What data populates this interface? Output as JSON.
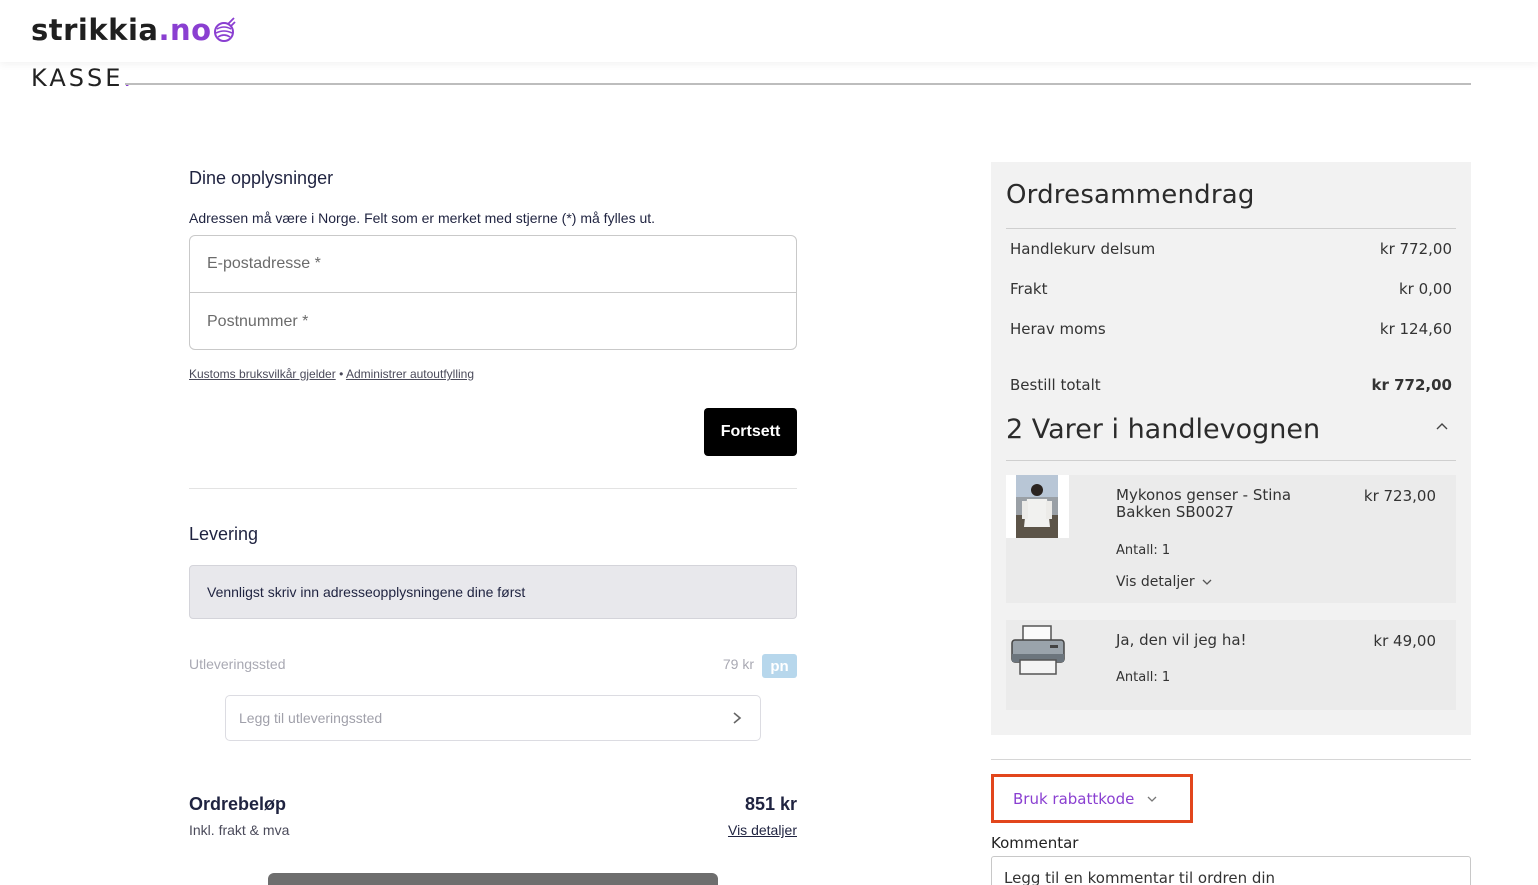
{
  "header": {
    "logo_text": "strikkia",
    "logo_accent": ".no",
    "brand_color": "#8a3fd1"
  },
  "page": {
    "title": "KASSE",
    "title_dot": "."
  },
  "customer": {
    "heading": "Dine opplysninger",
    "hint": "Adressen må være i Norge. Felt som er merket med stjerne (*) må fylles ut.",
    "email_placeholder": "E-postadresse *",
    "postcode_placeholder": "Postnummer *",
    "terms_link": "Kustoms bruksvilkår gjelder",
    "separator": "•",
    "autofill_link": "Administrer autoutfylling",
    "continue_label": "Fortsett"
  },
  "delivery": {
    "heading": "Levering",
    "notice": "Vennligst skriv inn adresseopplysningene dine først",
    "pickup_label": "Utleveringssted",
    "pickup_price": "79 kr",
    "carrier_badge": "pn",
    "pickup_placeholder": "Legg til utleveringssted"
  },
  "order_total": {
    "label": "Ordrebeløp",
    "sublabel": "Inkl. frakt & mva",
    "amount": "851 kr",
    "details_link": "Vis detaljer"
  },
  "summary": {
    "title": "Ordresammendrag",
    "rows": [
      {
        "label": "Handlekurv delsum",
        "value": "kr 772,00"
      },
      {
        "label": "Frakt",
        "value": "kr 0,00"
      },
      {
        "label": "Herav moms",
        "value": "kr 124,60"
      }
    ],
    "total": {
      "label": "Bestill totalt",
      "value": "kr 772,00"
    },
    "items_title": "2 Varer i handlevognen",
    "items": [
      {
        "name": "Mykonos genser - Stina Bakken SB0027",
        "price": "kr 723,00",
        "qty": "Antall: 1",
        "details": "Vis detaljer"
      },
      {
        "name": "Ja, den vil jeg ha!",
        "price": "kr 49,00",
        "qty": "Antall: 1"
      }
    ]
  },
  "discount": {
    "label": "Bruk rabattkode",
    "highlight_color": "#e2461c"
  },
  "comment": {
    "label": "Kommentar",
    "placeholder": "Legg til en kommentar til ordren din"
  }
}
